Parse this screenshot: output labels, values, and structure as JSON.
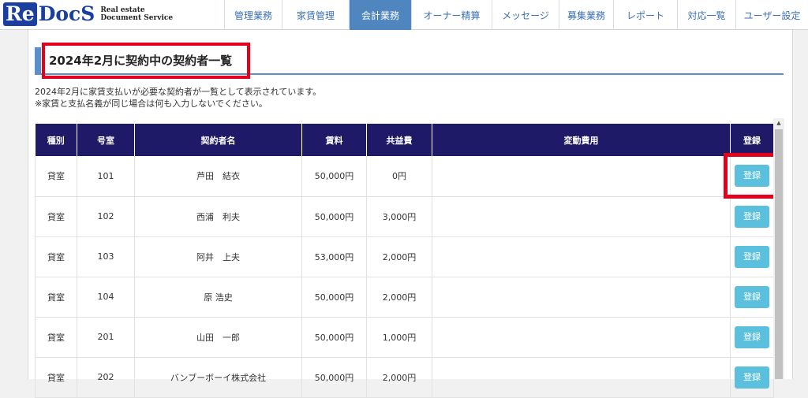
{
  "logo": {
    "re": "Re",
    "docs": "DocS",
    "sub1": "Real estate",
    "sub2": "Document Service"
  },
  "nav": [
    {
      "label": "管理業務",
      "w": 73
    },
    {
      "label": "家賃管理",
      "w": 85
    },
    {
      "label": "会計業務",
      "w": 79,
      "active": true
    },
    {
      "label": "オーナー精算",
      "w": 102
    },
    {
      "label": "メッセージ",
      "w": 85
    },
    {
      "label": "募集業務",
      "w": 69
    },
    {
      "label": "レポート",
      "w": 81
    },
    {
      "label": "対応一覧",
      "w": 74
    },
    {
      "label": "ユーザー設定",
      "w": 92
    }
  ],
  "page": {
    "title": "2024年2月に契約中の契約者一覧",
    "desc1": "2024年2月に家賃支払いが必要な契約者が一覧として表示されています。",
    "desc2": "※家賃と支払名義が同じ場合は何も入力しないでください。"
  },
  "table": {
    "headers": [
      "種別",
      "号室",
      "契約者名",
      "賃料",
      "共益費",
      "変動費用",
      "登録"
    ],
    "button_label": "登録",
    "rows": [
      {
        "type": "貸室",
        "room": "101",
        "name": "芦田　結衣",
        "rent": "50,000円",
        "fee": "0円",
        "var": ""
      },
      {
        "type": "貸室",
        "room": "102",
        "name": "西浦　利夫",
        "rent": "50,000円",
        "fee": "3,000円",
        "var": ""
      },
      {
        "type": "貸室",
        "room": "103",
        "name": "阿井　上夫",
        "rent": "53,000円",
        "fee": "2,000円",
        "var": ""
      },
      {
        "type": "貸室",
        "room": "104",
        "name": "原 浩史",
        "rent": "50,000円",
        "fee": "2,000円",
        "var": ""
      },
      {
        "type": "貸室",
        "room": "201",
        "name": "山田　一郎",
        "rent": "50,000円",
        "fee": "1,000円",
        "var": ""
      },
      {
        "type": "貸室",
        "room": "202",
        "name": "バンブーボーイ株式会社",
        "rent": "50,000円",
        "fee": "2,000円",
        "var": ""
      }
    ]
  }
}
